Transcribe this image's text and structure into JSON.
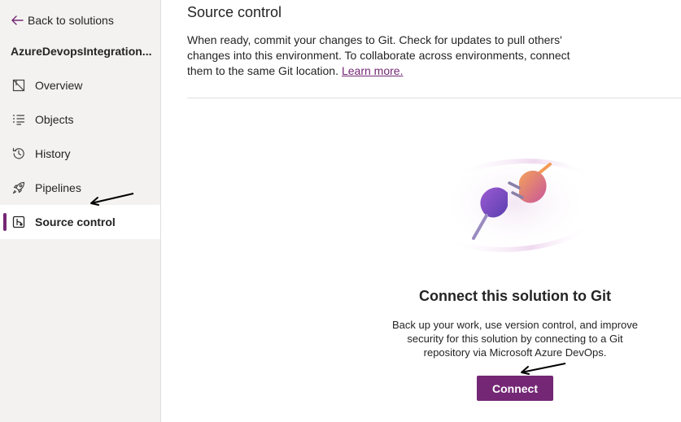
{
  "sidebar": {
    "back_label": "Back to solutions",
    "solution_name": "AzureDevopsIntegration...",
    "items": [
      {
        "label": "Overview",
        "icon": "overview-icon",
        "selected": false
      },
      {
        "label": "Objects",
        "icon": "objects-icon",
        "selected": false
      },
      {
        "label": "History",
        "icon": "history-icon",
        "selected": false
      },
      {
        "label": "Pipelines",
        "icon": "rocket-icon",
        "selected": false
      },
      {
        "label": "Source control",
        "icon": "source-control-icon",
        "selected": true
      }
    ]
  },
  "main": {
    "title": "Source control",
    "description": "When ready, commit your changes to Git. Check for updates to pull others' changes into this environment. To collaborate across environments, connect them to the same Git location.",
    "learn_more": "Learn more.",
    "empty_state": {
      "title": "Connect this solution to Git",
      "description": "Back up your work, use version control, and improve security for this solution by connecting to a Git repository via Microsoft Azure DevOps.",
      "button_label": "Connect",
      "illustration": "plug-connector-illustration"
    }
  },
  "colors": {
    "accent": "#742774",
    "sidebar_bg": "#f3f2f1",
    "text": "#242424"
  }
}
